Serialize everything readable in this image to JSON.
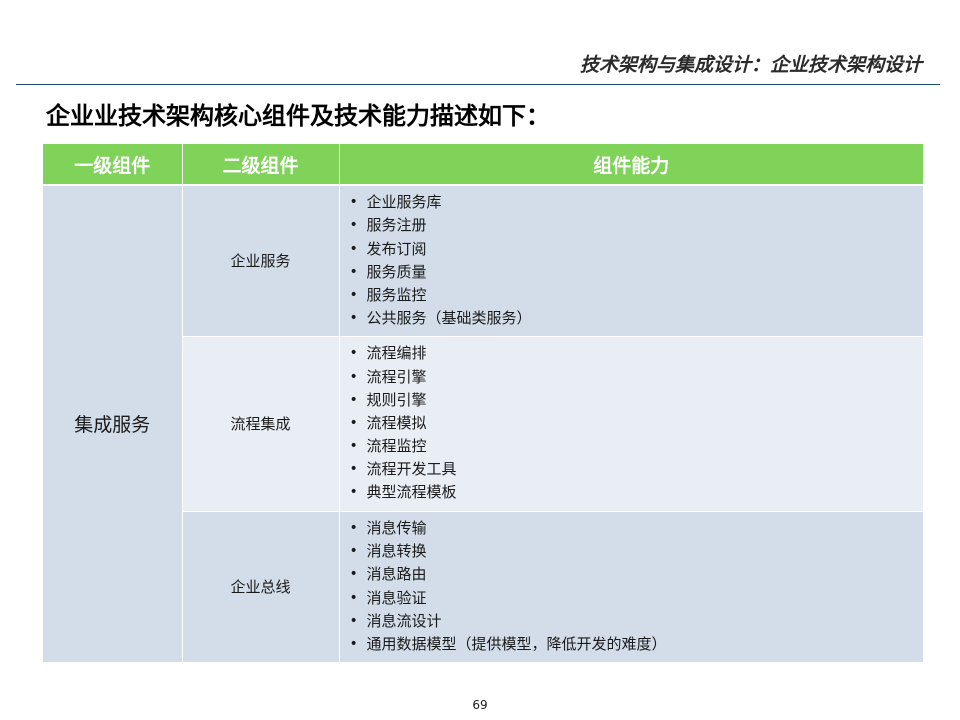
{
  "header": {
    "title": "技术架构与集成设计：企业技术架构设计"
  },
  "page_title": "企业业技术架构核心组件及技术能力描述如下：",
  "table": {
    "headers": [
      "一级组件",
      "二级组件",
      "组件能力"
    ],
    "level1": "集成服务",
    "groups": [
      {
        "name": "企业服务",
        "items": [
          "企业服务库",
          "服务注册",
          "发布订阅",
          "服务质量",
          "服务监控",
          "公共服务（基础类服务）"
        ]
      },
      {
        "name": "流程集成",
        "items": [
          "流程编排",
          "流程引擎",
          "规则引擎",
          "流程模拟",
          "流程监控",
          "流程开发工具",
          "典型流程模板"
        ]
      },
      {
        "name": "企业总线",
        "items": [
          "消息传输",
          "消息转换",
          "消息路由",
          "消息验证",
          "消息流设计",
          "通用数据模型（提供模型，降低开发的难度）"
        ]
      }
    ],
    "bullet": "•"
  },
  "page_number": "69",
  "colors": {
    "header_green": "#7fd358",
    "row_dark": "#d2dde9",
    "row_light": "#e9eef5",
    "rule": "#1f4f6f"
  }
}
